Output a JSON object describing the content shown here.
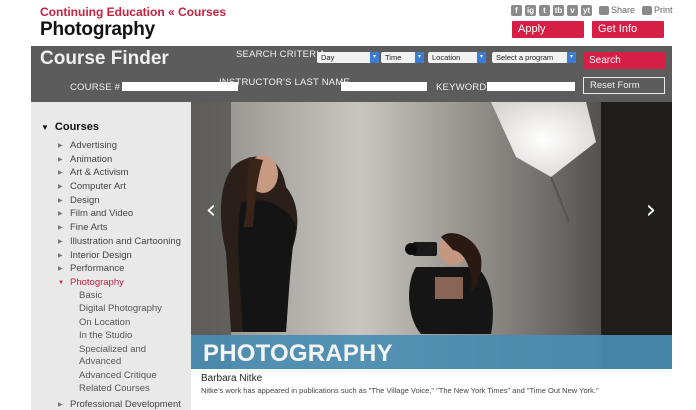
{
  "header": {
    "breadcrumb": "Continuing Education « Courses",
    "title": "Photography",
    "social": [
      "f",
      "ig",
      "t",
      "tb",
      "v",
      "yt"
    ],
    "share_label": "Share",
    "print_label": "Print",
    "apply_label": "Apply",
    "getinfo_label": "Get Info"
  },
  "finder": {
    "title": "Course Finder",
    "criteria_label": "SEARCH CRITERIA",
    "day": "Day",
    "time": "Time",
    "location": "Location",
    "program": "Select a program",
    "search_label": "Search",
    "course_label": "COURSE #",
    "instructor_label": "INSTRUCTOR'S LAST NAME",
    "keyword_label": "KEYWORD",
    "reset_label": "Reset Form",
    "course_value": "",
    "instructor_value": "",
    "keyword_value": ""
  },
  "sidebar": {
    "heading": "Courses",
    "categories": [
      "Advertising",
      "Animation",
      "Art & Activism",
      "Computer Art",
      "Design",
      "Film and Video",
      "Fine Arts",
      "Illustration and Cartooning",
      "Interior Design",
      "Performance",
      "Photography",
      "Professional Development"
    ],
    "subitems": [
      "Basic",
      "Digital Photography",
      "On Location",
      "In the Studio",
      "Specialized and",
      "Advanced",
      "Advanced Critique",
      "Related Courses"
    ]
  },
  "hero": {
    "title": "PHOTOGRAPHY",
    "caption_name": "Barbara Nitke",
    "caption_text": "Nitke's work has appeared in publications such as \"The Village Voice,\" \"The New York Times\" and \"Time Out New York.\""
  },
  "colors": {
    "accent": "#d61f45",
    "finder_bar": "#5c5c5c",
    "sidebar_bg": "#e9e9e9",
    "banner": "#4a8db3"
  }
}
